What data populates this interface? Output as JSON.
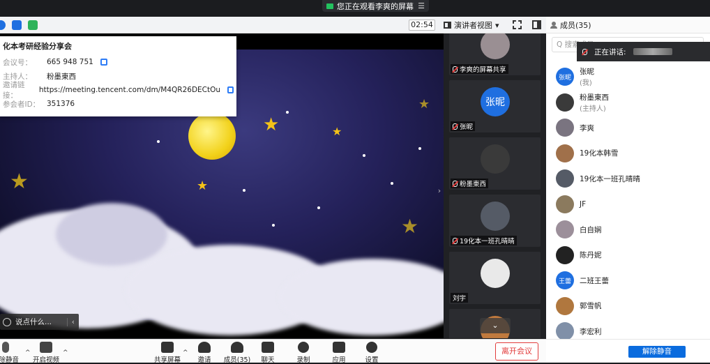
{
  "banner": {
    "text": "您正在观看李爽的屏幕",
    "menu_glyph": "☰"
  },
  "topbar": {
    "timer": "02:54",
    "view_label": "演讲者视图",
    "view_caret": "▾"
  },
  "members_header": {
    "title": "成员(35)"
  },
  "meeting_info": {
    "title": "化本考研经验分享会",
    "rows": [
      {
        "label": "会议号：",
        "value": "665 948 751"
      },
      {
        "label": "主持人：",
        "value": "粉墨東西"
      },
      {
        "label": "邀请链接：",
        "value": "https://meeting.tencent.com/dm/M4QR26DECtOu"
      },
      {
        "label": "参会者ID：",
        "value": "351376"
      }
    ]
  },
  "chat": {
    "placeholder": "说点什么...",
    "chevron": "‹"
  },
  "strip": {
    "collapse_glyph": "›",
    "tiles": [
      {
        "name": "李爽的屏幕共享"
      },
      {
        "name": "张昵",
        "avatar_text": "张昵"
      },
      {
        "name": "粉墨東西"
      },
      {
        "name": "19化本一班孔晴晴"
      },
      {
        "name": "刘宇"
      }
    ],
    "scroll_glyph": "⌄"
  },
  "members": {
    "search_placeholder": "Q 搜索成员",
    "speaking_label": "正在讲话:",
    "list": [
      {
        "name": "张昵",
        "sub": "(我)",
        "avatar_text": "张昵",
        "color": "#1f6fe0"
      },
      {
        "name": "粉墨東西",
        "sub": "(主持人)",
        "avatar_text": "",
        "color": "#3a3a3a"
      },
      {
        "name": "李爽",
        "sub": "",
        "avatar_text": "",
        "color": "#7a7480"
      },
      {
        "name": "19化本韩雪",
        "sub": "",
        "avatar_text": "",
        "color": "#a0704a"
      },
      {
        "name": "19化本一班孔晴晴",
        "sub": "",
        "avatar_text": "",
        "color": "#555b66"
      },
      {
        "name": "JF",
        "sub": "",
        "avatar_text": "",
        "color": "#8b7a5e"
      },
      {
        "name": "白自娴",
        "sub": "",
        "avatar_text": "",
        "color": "#9c8f9a"
      },
      {
        "name": "陈丹妮",
        "sub": "",
        "avatar_text": "",
        "color": "#222222"
      },
      {
        "name": "二班王蕾",
        "sub": "",
        "avatar_text": "王蕾",
        "color": "#1f6fe0"
      },
      {
        "name": "郭雪帆",
        "sub": "",
        "avatar_text": "",
        "color": "#b0773e"
      },
      {
        "name": "李宏利",
        "sub": "",
        "avatar_text": "",
        "color": "#8090a8"
      }
    ]
  },
  "bottom": {
    "tools": [
      {
        "label": "解除静音"
      },
      {
        "label": "开启视频"
      },
      {
        "label": "共享屏幕"
      },
      {
        "label": "邀请"
      },
      {
        "label": "成员(35)"
      },
      {
        "label": "聊天"
      },
      {
        "label": "录制"
      },
      {
        "label": "应用"
      },
      {
        "label": "设置"
      }
    ],
    "caret": "^",
    "leave_label": "离开会议"
  },
  "members_footer": {
    "unmute_all": "解除静音"
  },
  "colors": {
    "accent": "#0a6bde",
    "danger": "#e23c3c"
  }
}
